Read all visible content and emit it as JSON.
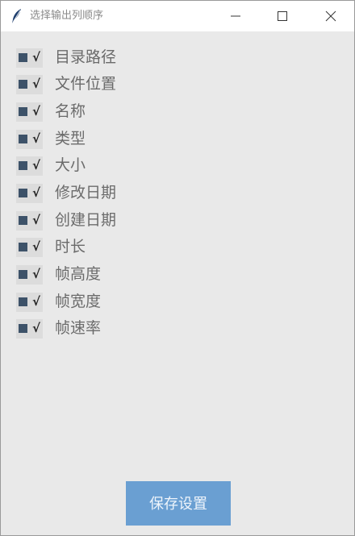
{
  "window": {
    "title": "选择输出列顺序",
    "title_icon": "feather-icon"
  },
  "columns": [
    {
      "label": "目录路径",
      "checked": true,
      "mark": "√"
    },
    {
      "label": "文件位置",
      "checked": true,
      "mark": "√"
    },
    {
      "label": "名称",
      "checked": true,
      "mark": "√"
    },
    {
      "label": "类型",
      "checked": true,
      "mark": "√"
    },
    {
      "label": "大小",
      "checked": true,
      "mark": "√"
    },
    {
      "label": "修改日期",
      "checked": true,
      "mark": "√"
    },
    {
      "label": "创建日期",
      "checked": true,
      "mark": "√"
    },
    {
      "label": "时长",
      "checked": true,
      "mark": "√"
    },
    {
      "label": "帧高度",
      "checked": true,
      "mark": "√"
    },
    {
      "label": "帧宽度",
      "checked": true,
      "mark": "√"
    },
    {
      "label": "帧速率",
      "checked": true,
      "mark": "√"
    }
  ],
  "save_button": {
    "label": "保存设置"
  },
  "colors": {
    "button_bg": "#6a9fd2",
    "checkbox_fill": "#3d5269",
    "window_bg": "#e9e9e9"
  }
}
